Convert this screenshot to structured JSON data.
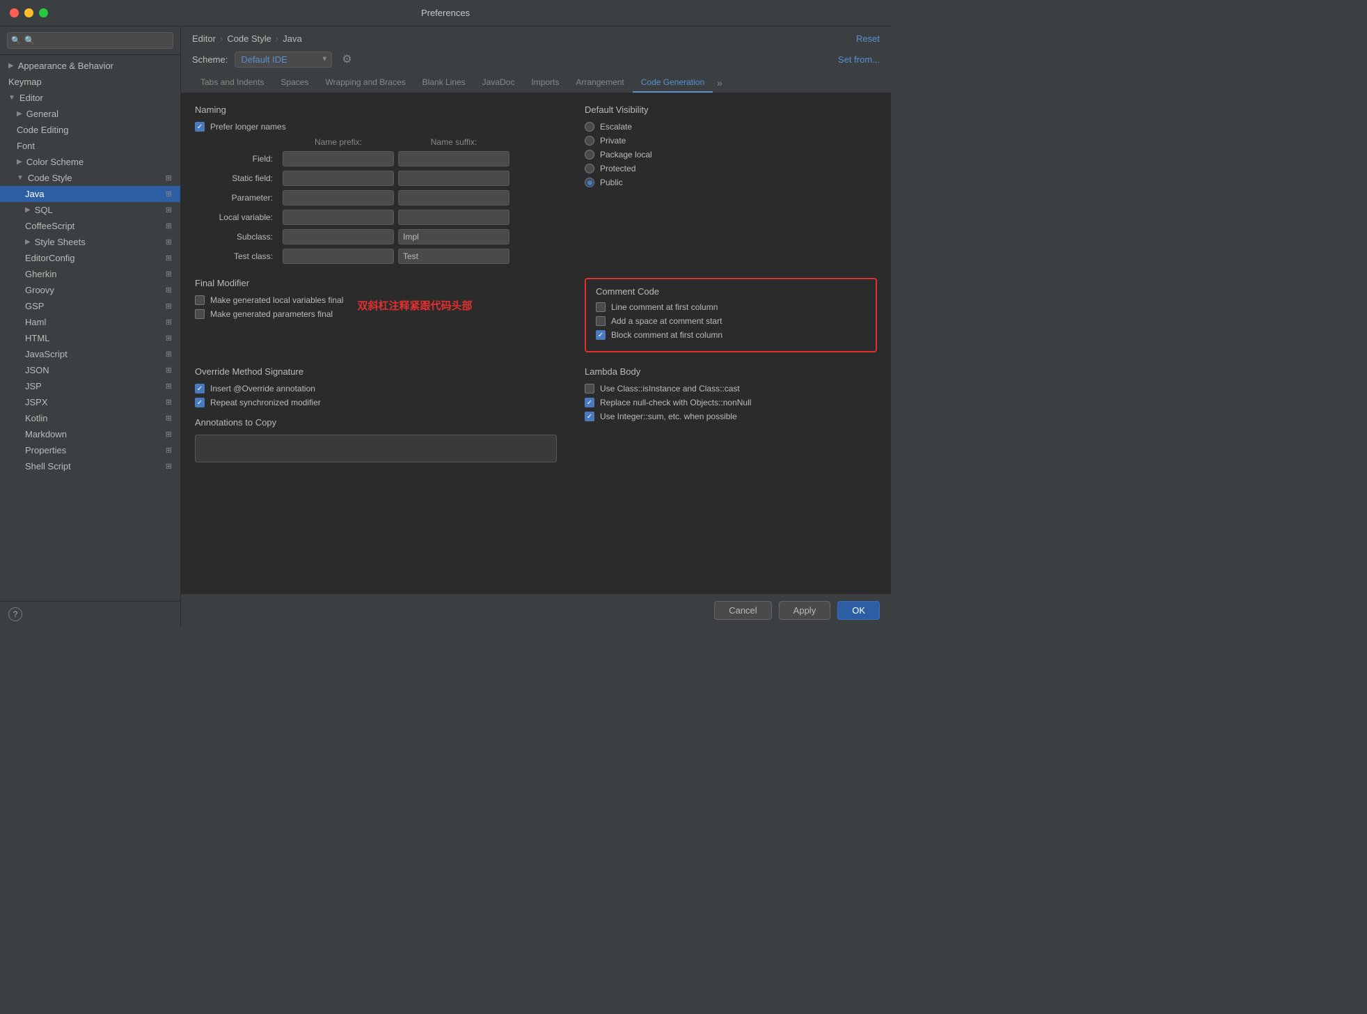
{
  "window": {
    "title": "Preferences"
  },
  "breadcrumb": {
    "editor": "Editor",
    "codeStyle": "Code Style",
    "java": "Java"
  },
  "scheme": {
    "label": "Scheme:",
    "value": "Default  IDE",
    "setFrom": "Set from..."
  },
  "reset": "Reset",
  "tabs": [
    {
      "id": "tabs-indents",
      "label": "Tabs and Indents"
    },
    {
      "id": "tab-spaces",
      "label": "Spaces"
    },
    {
      "id": "tab-wrapping",
      "label": "Wrapping and Braces"
    },
    {
      "id": "tab-blank",
      "label": "Blank Lines"
    },
    {
      "id": "tab-javadoc",
      "label": "JavaDoc"
    },
    {
      "id": "tab-imports",
      "label": "Imports"
    },
    {
      "id": "tab-arrangement",
      "label": "Arrangement"
    },
    {
      "id": "tab-codegeneration",
      "label": "Code Generation",
      "active": true
    }
  ],
  "sidebar": {
    "search_placeholder": "🔍",
    "items": [
      {
        "id": "appearance",
        "label": "Appearance & Behavior",
        "indent": 0,
        "chevron": "▶",
        "expanded": false
      },
      {
        "id": "keymap",
        "label": "Keymap",
        "indent": 0,
        "expanded": false
      },
      {
        "id": "editor",
        "label": "Editor",
        "indent": 0,
        "chevron": "▼",
        "expanded": true
      },
      {
        "id": "general",
        "label": "General",
        "indent": 1,
        "chevron": "▶",
        "expanded": false
      },
      {
        "id": "codeediting",
        "label": "Code Editing",
        "indent": 1,
        "expanded": false
      },
      {
        "id": "font",
        "label": "Font",
        "indent": 1,
        "expanded": false
      },
      {
        "id": "colorscheme",
        "label": "Color Scheme",
        "indent": 1,
        "chevron": "▶",
        "expanded": false
      },
      {
        "id": "codestyle",
        "label": "Code Style",
        "indent": 1,
        "chevron": "▼",
        "expanded": true,
        "icon": "📋"
      },
      {
        "id": "java",
        "label": "Java",
        "indent": 2,
        "selected": true,
        "icon": "📋"
      },
      {
        "id": "sql",
        "label": "SQL",
        "indent": 2,
        "chevron": "▶",
        "icon": "📋"
      },
      {
        "id": "coffeescript",
        "label": "CoffeeScript",
        "indent": 2,
        "icon": "📋"
      },
      {
        "id": "stylesheets",
        "label": "Style Sheets",
        "indent": 2,
        "chevron": "▶",
        "icon": "📋"
      },
      {
        "id": "editorconfig",
        "label": "EditorConfig",
        "indent": 2,
        "icon": "📋"
      },
      {
        "id": "gherkin",
        "label": "Gherkin",
        "indent": 2,
        "icon": "📋"
      },
      {
        "id": "groovy",
        "label": "Groovy",
        "indent": 2,
        "icon": "📋"
      },
      {
        "id": "gsp",
        "label": "GSP",
        "indent": 2,
        "icon": "📋"
      },
      {
        "id": "haml",
        "label": "Haml",
        "indent": 2,
        "icon": "📋"
      },
      {
        "id": "html",
        "label": "HTML",
        "indent": 2,
        "icon": "📋"
      },
      {
        "id": "javascript",
        "label": "JavaScript",
        "indent": 2,
        "icon": "📋"
      },
      {
        "id": "json",
        "label": "JSON",
        "indent": 2,
        "icon": "📋"
      },
      {
        "id": "jsp",
        "label": "JSP",
        "indent": 2,
        "icon": "📋"
      },
      {
        "id": "jspx",
        "label": "JSPX",
        "indent": 2,
        "icon": "📋"
      },
      {
        "id": "kotlin",
        "label": "Kotlin",
        "indent": 2,
        "icon": "📋"
      },
      {
        "id": "markdown",
        "label": "Markdown",
        "indent": 2,
        "icon": "📋"
      },
      {
        "id": "properties",
        "label": "Properties",
        "indent": 2,
        "icon": "📋"
      },
      {
        "id": "shellscript",
        "label": "Shell Script",
        "indent": 2,
        "icon": "📋"
      }
    ]
  },
  "content": {
    "naming": {
      "title": "Naming",
      "preferLongerNames": "Prefer longer names",
      "preferLongerNamesChecked": true,
      "namePrefix": "Name prefix:",
      "nameSuffix": "Name suffix:",
      "rows": [
        {
          "label": "Field:",
          "prefix": "",
          "suffix": ""
        },
        {
          "label": "Static field:",
          "prefix": "",
          "suffix": ""
        },
        {
          "label": "Parameter:",
          "prefix": "",
          "suffix": ""
        },
        {
          "label": "Local variable:",
          "prefix": "",
          "suffix": ""
        },
        {
          "label": "Subclass:",
          "prefix": "",
          "suffix": "Impl"
        },
        {
          "label": "Test class:",
          "prefix": "",
          "suffix": "Test"
        }
      ]
    },
    "defaultVisibility": {
      "title": "Default Visibility",
      "options": [
        {
          "label": "Escalate",
          "checked": false
        },
        {
          "label": "Private",
          "checked": false
        },
        {
          "label": "Package local",
          "checked": false
        },
        {
          "label": "Protected",
          "checked": false
        },
        {
          "label": "Public",
          "checked": true
        }
      ]
    },
    "finalModifier": {
      "title": "Final Modifier",
      "annotationText": "双斜杠注释紧跟代码头部",
      "options": [
        {
          "label": "Make generated local variables final",
          "checked": false
        },
        {
          "label": "Make generated parameters final",
          "checked": false
        }
      ]
    },
    "commentCode": {
      "title": "Comment Code",
      "options": [
        {
          "label": "Line comment at first column",
          "checked": false
        },
        {
          "label": "Add a space at comment start",
          "checked": false
        },
        {
          "label": "Block comment at first column",
          "checked": true
        }
      ]
    },
    "overrideMethodSignature": {
      "title": "Override Method Signature",
      "options": [
        {
          "label": "Insert @Override annotation",
          "checked": true
        },
        {
          "label": "Repeat synchronized modifier",
          "checked": true
        }
      ]
    },
    "annotationsToCopy": {
      "title": "Annotations to Copy"
    },
    "lambdaBody": {
      "title": "Lambda Body",
      "options": [
        {
          "label": "Use Class::isInstance and Class::cast",
          "checked": false
        },
        {
          "label": "Replace null-check with Objects::nonNull",
          "checked": true
        },
        {
          "label": "Use Integer::sum, etc. when possible",
          "checked": true
        }
      ]
    }
  },
  "buttons": {
    "cancel": "Cancel",
    "apply": "Apply",
    "ok": "OK"
  }
}
